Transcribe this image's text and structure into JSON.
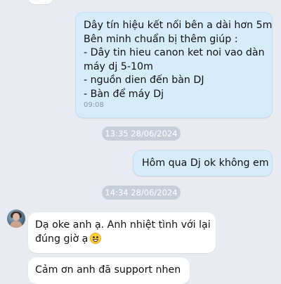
{
  "messages": {
    "m1": {
      "lines": [
        "Dây tín hiệu kết nối bên a dài hơn 5m",
        "Bên minh chuẩn bị thêm giúp :",
        "- Dây tin hieu canon ket noi vao dàn",
        "máy dj 5-10m",
        "- nguồn dien đến bàn DJ",
        "- Bàn để máy Dj"
      ],
      "time": "09:08"
    },
    "date1": "13:35 28/06/2024",
    "m2": {
      "text": "Hôm qua Dj ok không em"
    },
    "date2": "14:34 28/06/2024",
    "m3": {
      "lines": [
        "Dạ oke anh ạ. Anh nhiệt tình với lại",
        "đúng giờ ạ"
      ],
      "emoji": "grinning-face-emoji"
    },
    "m4": {
      "text": "Cảm ơn anh đã support nhen"
    }
  }
}
